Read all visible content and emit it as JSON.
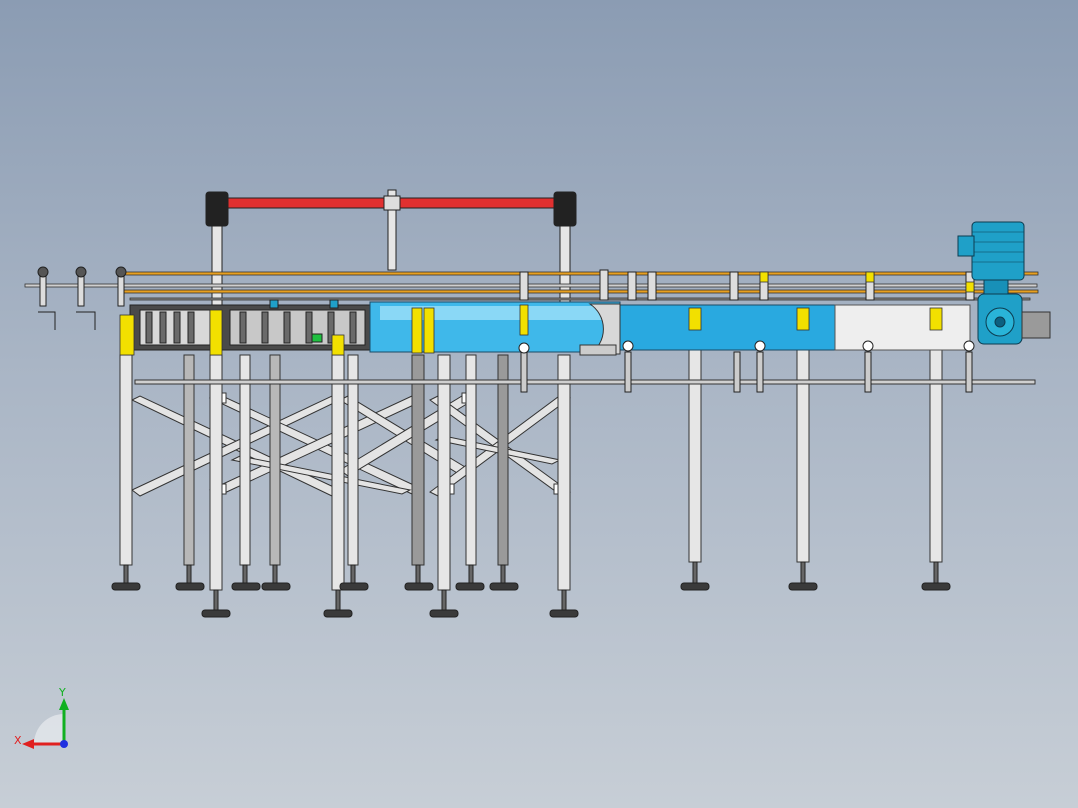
{
  "viewport": {
    "background_top": "#8b9cb3",
    "background_bottom": "#c7ced6"
  },
  "colors": {
    "frame": "#e8e8e8",
    "frame_stroke": "#333333",
    "guide_rail_red": "#e03030",
    "conveyor_blue": "#29a9e0",
    "conveyor_light": "#5cc8f0",
    "bracket_yellow": "#f2e000",
    "rail_orange": "#e8a020",
    "motor_blue": "#1fa0c8",
    "housing_black": "#222222"
  },
  "triad": {
    "x_label": "X",
    "y_label": "Y",
    "x_color": "#e02020",
    "y_color": "#10b020",
    "z_color": "#2030e0"
  },
  "icons": [
    "coordinate-triad-icon",
    "drive-motor-icon",
    "gearbox-icon"
  ]
}
